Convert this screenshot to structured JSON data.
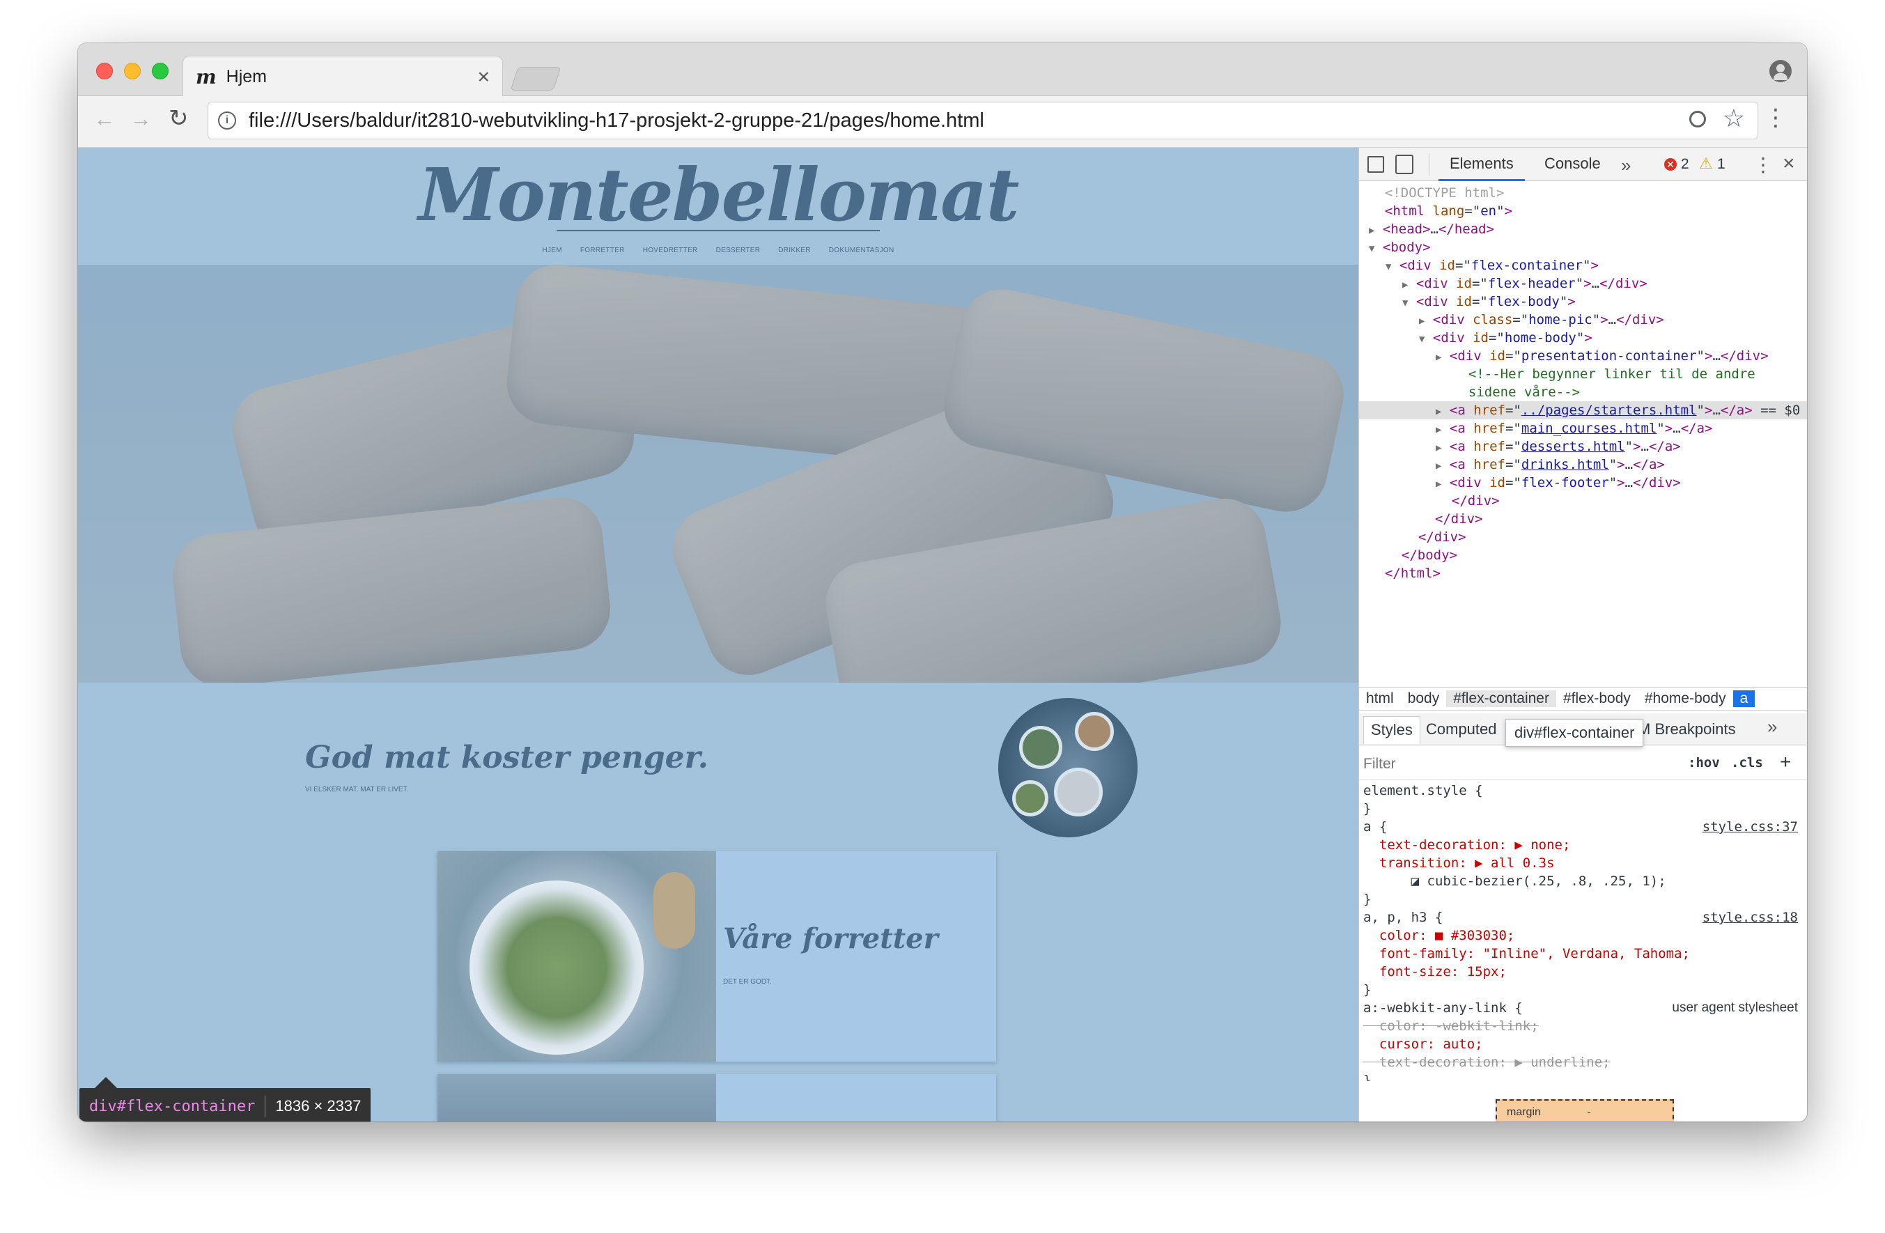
{
  "browser": {
    "tab_title": "Hjem",
    "url": "file:///Users/baldur/it2810-webutvikling-h17-prosjekt-2-gruppe-21/pages/home.html",
    "close_tab": "×"
  },
  "site": {
    "logo": "Montebellomat",
    "nav": [
      "HJEM",
      "FORRETTER",
      "HOVEDRETTER",
      "DESSERTER",
      "DRIKKER",
      "DOKUMENTASJON"
    ],
    "slogan": "God mat koster penger.",
    "sub_slogan": "VI ELSKER MAT. MAT ER LIVET.",
    "card1_title": "Våre forretter",
    "card1_sub": "DET ER GODT."
  },
  "inspect_tooltip": {
    "selector": "div#flex-container",
    "size": "1836 × 2337"
  },
  "devtools": {
    "tabs": [
      "Elements",
      "Console"
    ],
    "more": "»",
    "errors": "2",
    "warnings": "1",
    "tree": [
      {
        "indent": 0,
        "html": "<span class='g'>&lt;!DOCTYPE html&gt;</span>"
      },
      {
        "indent": 0,
        "html": "<span class='t'>&lt;html </span><span class='a'>lang</span>=\"<span class='v'>en</span>\"<span class='t'>&gt;</span>"
      },
      {
        "indent": 0,
        "arrow": "▶",
        "html": "<span class='t'>&lt;head&gt;</span>…<span class='t'>&lt;/head&gt;</span>"
      },
      {
        "indent": 0,
        "arrow": "▼",
        "html": "<span class='t'>&lt;body&gt;</span>"
      },
      {
        "indent": 1,
        "arrow": "▼",
        "html": "<span class='t'>&lt;div </span><span class='a'>id</span>=\"<span class='v'>flex-container</span>\"<span class='t'>&gt;</span>"
      },
      {
        "indent": 2,
        "arrow": "▶",
        "html": "<span class='t'>&lt;div </span><span class='a'>id</span>=\"<span class='v'>flex-header</span>\"<span class='t'>&gt;</span>…<span class='t'>&lt;/div&gt;</span>"
      },
      {
        "indent": 2,
        "arrow": "▼",
        "html": "<span class='t'>&lt;div </span><span class='a'>id</span>=\"<span class='v'>flex-body</span>\"<span class='t'>&gt;</span>"
      },
      {
        "indent": 3,
        "arrow": "▶",
        "html": "<span class='t'>&lt;div </span><span class='a'>class</span>=\"<span class='v'>home-pic</span>\"<span class='t'>&gt;</span>…<span class='t'>&lt;/div&gt;</span>"
      },
      {
        "indent": 3,
        "arrow": "▼",
        "html": "<span class='t'>&lt;div </span><span class='a'>id</span>=\"<span class='v'>home-body</span>\"<span class='t'>&gt;</span>"
      },
      {
        "indent": 4,
        "arrow": "▶",
        "html": "<span class='t'>&lt;div </span><span class='a'>id</span>=\"<span class='v'>presentation-container</span>\"<span class='t'>&gt;</span>…<span class='t'>&lt;/div&gt;</span>"
      },
      {
        "indent": 5,
        "html": "<span class='c'>&lt;!--Her begynner linker til de andre</span>"
      },
      {
        "indent": 5,
        "html": "<span class='c'>sidene våre--&gt;</span>"
      },
      {
        "indent": 4,
        "arrow": "▶",
        "sel": true,
        "html": "<span class='t'>&lt;a </span><span class='a'>href</span>=\"<span class='lk'>../pages/starters.html</span>\"<span class='t'>&gt;</span>…<span class='t'>&lt;/a&gt;</span> == $0"
      },
      {
        "indent": 4,
        "arrow": "▶",
        "html": "<span class='t'>&lt;a </span><span class='a'>href</span>=\"<span class='lk'>main_courses.html</span>\"<span class='t'>&gt;</span>…<span class='t'>&lt;/a&gt;</span>"
      },
      {
        "indent": 4,
        "arrow": "▶",
        "html": "<span class='t'>&lt;a </span><span class='a'>href</span>=\"<span class='lk'>desserts.html</span>\"<span class='t'>&gt;</span>…<span class='t'>&lt;/a&gt;</span>"
      },
      {
        "indent": 4,
        "arrow": "▶",
        "html": "<span class='t'>&lt;a </span><span class='a'>href</span>=\"<span class='lk'>drinks.html</span>\"<span class='t'>&gt;</span>…<span class='t'>&lt;/a&gt;</span>"
      },
      {
        "indent": 4,
        "arrow": "▶",
        "html": "<span class='t'>&lt;div </span><span class='a'>id</span>=\"<span class='v'>flex-footer</span>\"<span class='t'>&gt;</span>…<span class='t'>&lt;/div&gt;</span>"
      },
      {
        "indent": 4,
        "html": "<span class='t'>&lt;/div&gt;</span>"
      },
      {
        "indent": 3,
        "html": "<span class='t'>&lt;/div&gt;</span>"
      },
      {
        "indent": 2,
        "html": "<span class='t'>&lt;/div&gt;</span>"
      },
      {
        "indent": 1,
        "html": "<span class='t'>&lt;/body&gt;</span>"
      },
      {
        "indent": 0,
        "html": "<span class='t'>&lt;/html&gt;</span>"
      }
    ],
    "breadcrumbs": [
      "html",
      "body",
      "#flex-container",
      "#flex-body",
      "#home-body",
      "a"
    ],
    "style_tabs": [
      "Styles",
      "Computed"
    ],
    "style_tooltip": "div#flex-container",
    "dom_breakpoints": "M Breakpoints",
    "filter_placeholder": "Filter",
    "hov": ":hov",
    "cls": ".cls",
    "add": "+",
    "rules": [
      {
        "text": "element.style {"
      },
      {
        "text": "}"
      },
      {
        "text": "a {",
        "src": "style.css:37"
      },
      {
        "text": "  text-decoration: ▶ none;",
        "prop": true
      },
      {
        "text": "  transition: ▶ all 0.3s",
        "prop": true
      },
      {
        "text": "      ◪ cubic-bezier(.25, .8, .25, 1);"
      },
      {
        "text": "}"
      },
      {
        "text": "a, p, h3 {",
        "src": "style.css:18"
      },
      {
        "text": "  color: ■ #303030;",
        "prop": true
      },
      {
        "text": "  font-family: \"Inline\", Verdana, Tahoma;",
        "prop": true
      },
      {
        "text": "  font-size: 15px;",
        "prop": true
      },
      {
        "text": "}"
      },
      {
        "text": "a:-webkit-any-link {",
        "src": "user agent stylesheet",
        "ua": true
      },
      {
        "text": "  color: -webkit-link;",
        "strike": true
      },
      {
        "text": "  cursor: auto;",
        "prop": true
      },
      {
        "text": "  text-decoration: ▶ underline;",
        "strike": true
      },
      {
        "text": "}"
      }
    ],
    "box_margin_label": "margin",
    "box_margin_value": "-"
  }
}
